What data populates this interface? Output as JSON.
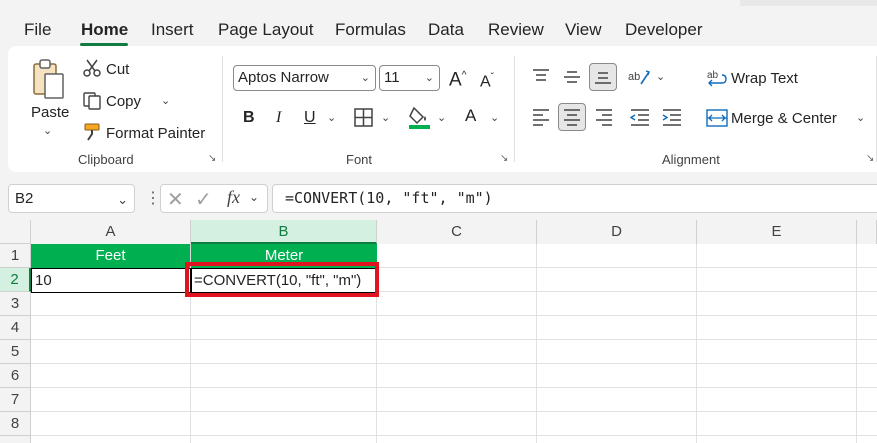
{
  "menu": {
    "tabs": [
      "File",
      "Home",
      "Insert",
      "Page Layout",
      "Formulas",
      "Data",
      "Review",
      "View",
      "Developer"
    ],
    "active_tab": "Home"
  },
  "ribbon": {
    "clipboard": {
      "paste": "Paste",
      "cut": "Cut",
      "copy": "Copy",
      "format_painter": "Format Painter",
      "group_label": "Clipboard"
    },
    "font": {
      "font_name": "Aptos Narrow",
      "font_size": "11",
      "bold": "B",
      "italic": "I",
      "underline": "U",
      "font_color_glyph": "A",
      "group_label": "Font"
    },
    "alignment": {
      "wrap_text": "Wrap Text",
      "merge_center": "Merge & Center",
      "group_label": "Alignment"
    }
  },
  "formula_bar": {
    "name_box": "B2",
    "fx": "fx",
    "formula": "=CONVERT(10, \"ft\", \"m\")"
  },
  "sheet": {
    "columns": [
      "A",
      "B",
      "C",
      "D",
      "E"
    ],
    "rows": [
      "1",
      "2",
      "3",
      "4",
      "5",
      "6",
      "7",
      "8"
    ],
    "selected_cell": "B2",
    "header_fill": "#00b050",
    "highlight_border": "#e0141e",
    "cells": {
      "A1": "Feet",
      "B1": "Meter",
      "A2": "10",
      "B2": "=CONVERT(10, \"ft\", \"m\")"
    }
  }
}
